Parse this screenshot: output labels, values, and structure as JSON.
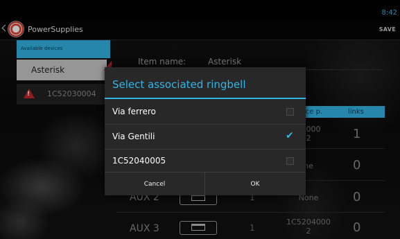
{
  "status_bar": {
    "clock": "8:42"
  },
  "action_bar": {
    "title": "PowerSupplies",
    "save_label": "SAVE"
  },
  "left_panel": {
    "header": "Available devices",
    "items": [
      {
        "label": "Asterisk",
        "state": "selected"
      },
      {
        "label": "1C52030004",
        "state": "warning"
      }
    ]
  },
  "detail": {
    "item_name_label": "Item name:",
    "item_name_value": "Asterisk",
    "columns": {
      "device": "ice p.",
      "links": "links"
    },
    "rows": [
      {
        "name": "",
        "number": "",
        "device_top": "04000",
        "device_bottom": "2",
        "links": "1"
      },
      {
        "name": "",
        "number": "",
        "device_top": "ne",
        "device_bottom": "",
        "links": "0"
      },
      {
        "name": "AUX 2",
        "number": "1",
        "device_top": "None",
        "device_bottom": "",
        "links": "0"
      },
      {
        "name": "AUX 3",
        "number": "1",
        "device_top": "1C5204000",
        "device_bottom": "2",
        "links": "0"
      }
    ]
  },
  "dialog": {
    "title": "Select associated ringbell",
    "options": [
      {
        "label": "Via ferrero",
        "checked": false
      },
      {
        "label": "Via Gentili",
        "checked": true
      },
      {
        "label": "1C52040005",
        "checked": false
      }
    ],
    "cancel_label": "Cancel",
    "ok_label": "OK"
  },
  "colors": {
    "accent": "#33b5e5",
    "warning": "#c1282b"
  }
}
